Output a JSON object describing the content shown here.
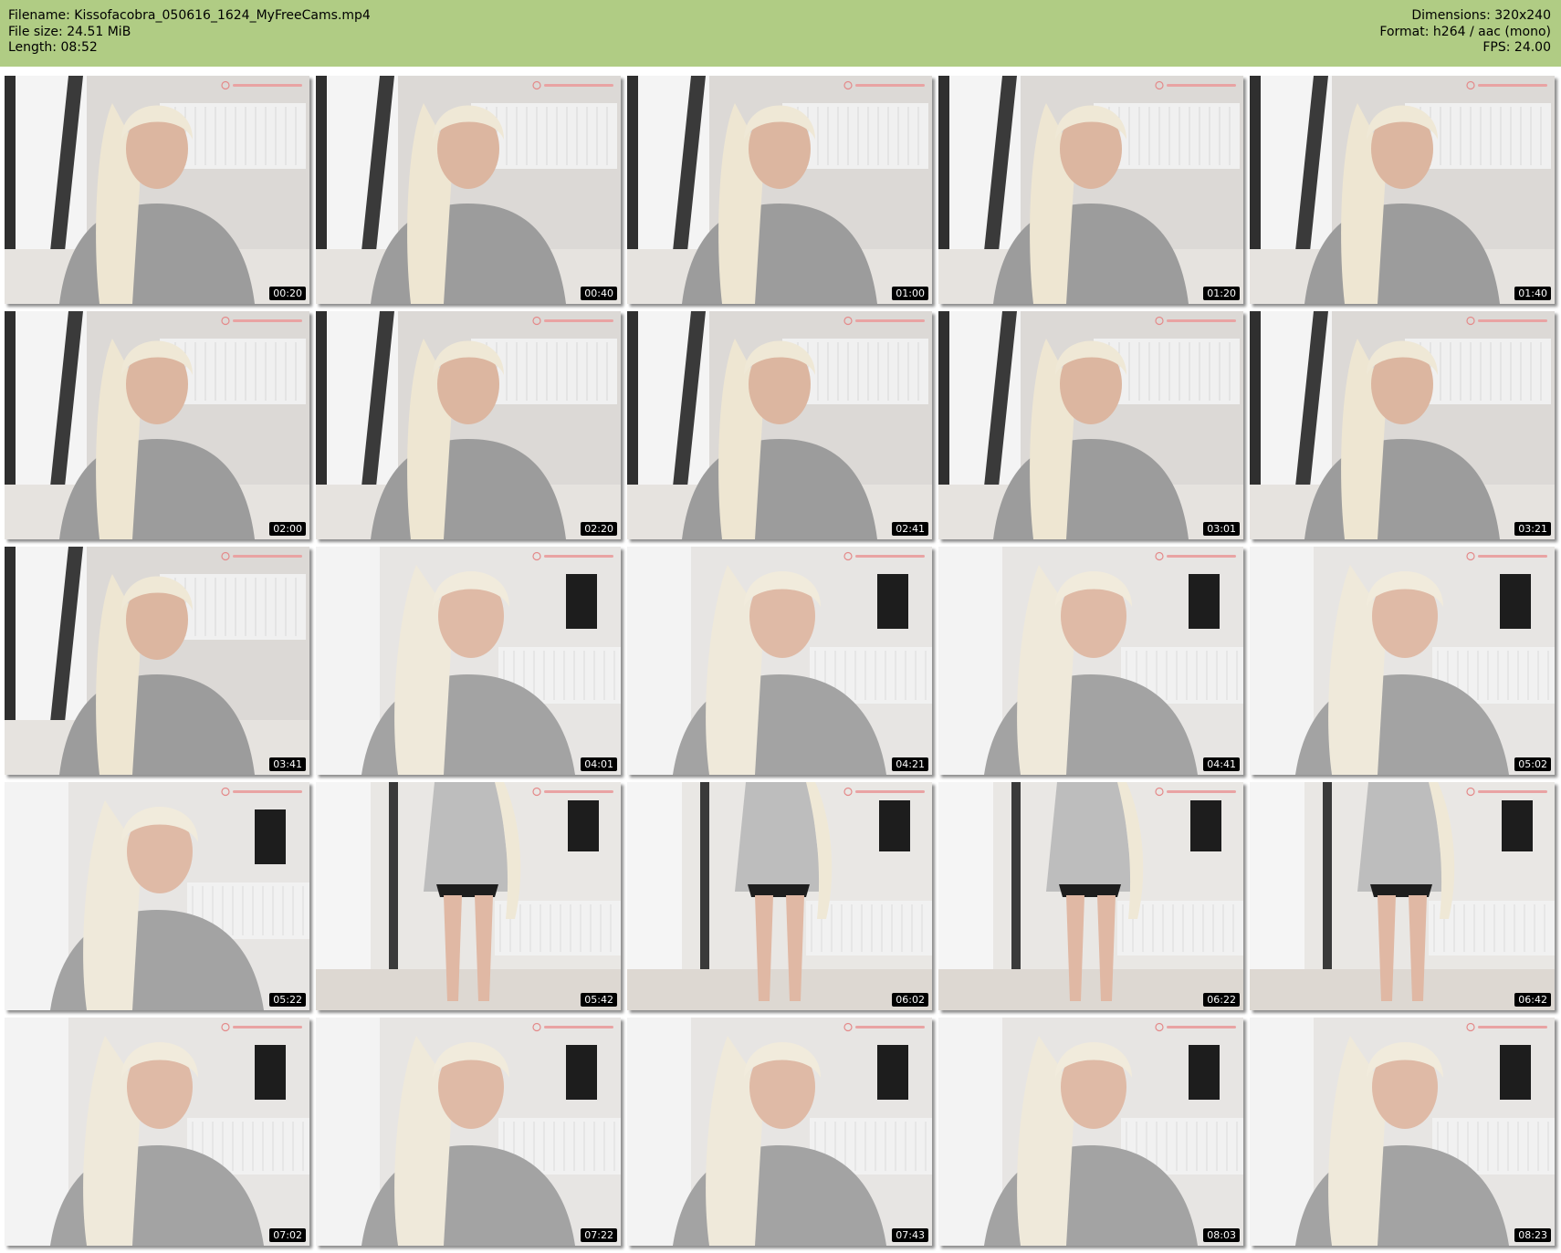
{
  "header": {
    "filename": "Filename: Kissofacobra_050616_1624_MyFreeCams.mp4",
    "file_size": "File size: 24.51 MiB",
    "length": "Length: 08:52",
    "dimensions": "Dimensions: 320x240",
    "format": "Format: h264 / aac (mono)",
    "fps": "FPS: 24.00"
  },
  "colors": {
    "header_bg": "#b0cc84",
    "timestamp_bg": "#000000",
    "timestamp_fg": "#ffffff"
  },
  "frames": [
    {
      "time": "00:20",
      "scene": "window-seated"
    },
    {
      "time": "00:40",
      "scene": "window-seated"
    },
    {
      "time": "01:00",
      "scene": "window-seated"
    },
    {
      "time": "01:20",
      "scene": "window-seated"
    },
    {
      "time": "01:40",
      "scene": "window-seated"
    },
    {
      "time": "02:00",
      "scene": "window-seated"
    },
    {
      "time": "02:20",
      "scene": "window-seated"
    },
    {
      "time": "02:41",
      "scene": "window-seated"
    },
    {
      "time": "03:01",
      "scene": "window-seated"
    },
    {
      "time": "03:21",
      "scene": "window-seated"
    },
    {
      "time": "03:41",
      "scene": "window-seated"
    },
    {
      "time": "04:01",
      "scene": "tv-seated"
    },
    {
      "time": "04:21",
      "scene": "tv-seated"
    },
    {
      "time": "04:41",
      "scene": "tv-seated"
    },
    {
      "time": "05:02",
      "scene": "tv-seated"
    },
    {
      "time": "05:22",
      "scene": "tv-seated"
    },
    {
      "time": "05:42",
      "scene": "standing"
    },
    {
      "time": "06:02",
      "scene": "standing"
    },
    {
      "time": "06:22",
      "scene": "standing"
    },
    {
      "time": "06:42",
      "scene": "standing"
    },
    {
      "time": "07:02",
      "scene": "tv-seated"
    },
    {
      "time": "07:22",
      "scene": "tv-seated"
    },
    {
      "time": "07:43",
      "scene": "tv-seated"
    },
    {
      "time": "08:03",
      "scene": "tv-seated"
    },
    {
      "time": "08:23",
      "scene": "tv-seated"
    }
  ]
}
